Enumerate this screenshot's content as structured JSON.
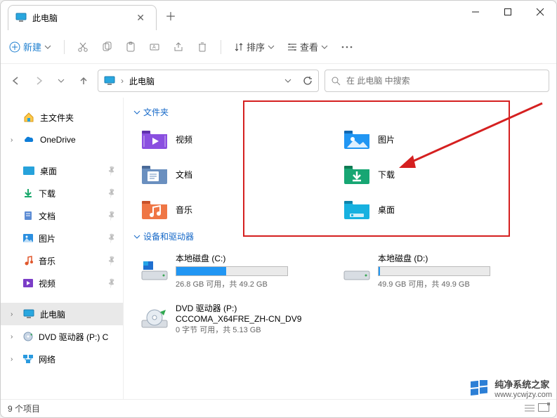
{
  "tab": {
    "title": "此电脑"
  },
  "toolbar": {
    "new": "新建",
    "sort": "排序",
    "view": "查看"
  },
  "address": {
    "location": "此电脑",
    "search_placeholder": "在 此电脑 中搜索"
  },
  "sidebar": {
    "home": "主文件夹",
    "onedrive": "OneDrive",
    "desktop": "桌面",
    "downloads": "下载",
    "documents": "文档",
    "pictures": "图片",
    "music": "音乐",
    "videos": "视频",
    "thispc": "此电脑",
    "dvd": "DVD 驱动器 (P:) C",
    "network": "网络"
  },
  "sections": {
    "folders": "文件夹",
    "drives": "设备和驱动器"
  },
  "folders": {
    "videos": "视频",
    "pictures": "图片",
    "documents": "文档",
    "downloads": "下载",
    "music": "音乐",
    "desktop": "桌面"
  },
  "drives": {
    "c": {
      "name": "本地磁盘 (C:)",
      "detail": "26.8 GB 可用，共 49.2 GB",
      "fillPct": 45
    },
    "d": {
      "name": "本地磁盘 (D:)",
      "detail": "49.9 GB 可用，共 49.9 GB",
      "fillPct": 1
    },
    "p": {
      "name": "DVD 驱动器 (P:)",
      "label": "CCCOMA_X64FRE_ZH-CN_DV9",
      "detail": "0 字节 可用，共 5.13 GB"
    }
  },
  "status": {
    "count": "9 个项目"
  },
  "watermark": {
    "name": "纯净系统之家",
    "url": "www.ycwjzy.com"
  }
}
